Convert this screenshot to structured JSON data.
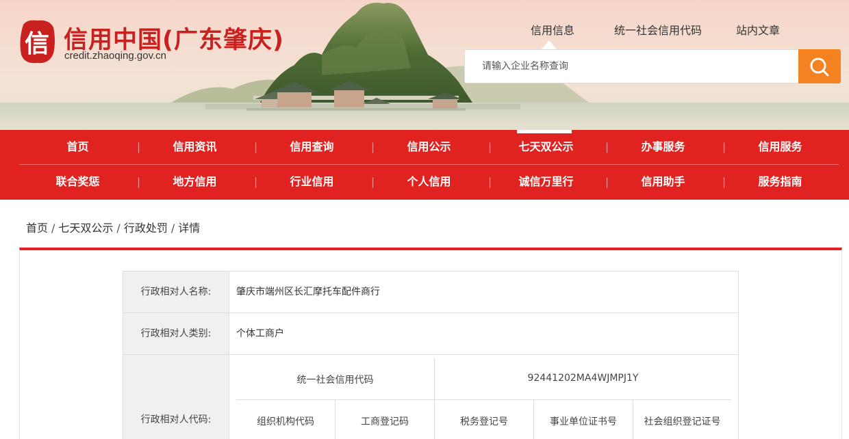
{
  "header": {
    "logo_seal_char": "信",
    "site_title": "信用中国(广东肇庆)",
    "site_url": "credit.zhaoqing.gov.cn",
    "top_nav": [
      {
        "label": "信用信息",
        "active": true
      },
      {
        "label": "统一社会信用代码",
        "active": false
      },
      {
        "label": "站内文章",
        "active": false
      }
    ],
    "search": {
      "placeholder": "请输入企业名称查询",
      "value": "",
      "button_icon": "search-icon"
    },
    "colors": {
      "brand_red": "#c8211f",
      "nav_red": "#e02221",
      "search_orange": "#f58220"
    }
  },
  "main_nav": {
    "row1": [
      {
        "label": "首页"
      },
      {
        "label": "信用资讯"
      },
      {
        "label": "信用查询"
      },
      {
        "label": "信用公示"
      },
      {
        "label": "七天双公示",
        "active": true
      },
      {
        "label": "办事服务"
      },
      {
        "label": "信用服务"
      }
    ],
    "row2": [
      {
        "label": "联合奖惩"
      },
      {
        "label": "地方信用"
      },
      {
        "label": "行业信用"
      },
      {
        "label": "个人信用"
      },
      {
        "label": "诚信万里行"
      },
      {
        "label": "信用助手"
      },
      {
        "label": "服务指南"
      }
    ],
    "separator": "|"
  },
  "breadcrumb": {
    "items": [
      "首页",
      "七天双公示",
      "行政处罚",
      "详情"
    ],
    "separator": "/"
  },
  "detail": {
    "name_label": "行政相对人名称:",
    "name_value": "肇庆市端州区长汇摩托车配件商行",
    "type_label": "行政相对人类别:",
    "type_value": "个体工商户",
    "code_label": "行政相对人代码:",
    "credit_code_label": "统一社会信用代码",
    "credit_code_value": "92441202MA4WJMPJ1Y",
    "sub_headers": [
      "组织机构代码",
      "工商登记码",
      "税务登记号",
      "事业单位证书号",
      "社会组织登记证号"
    ]
  }
}
